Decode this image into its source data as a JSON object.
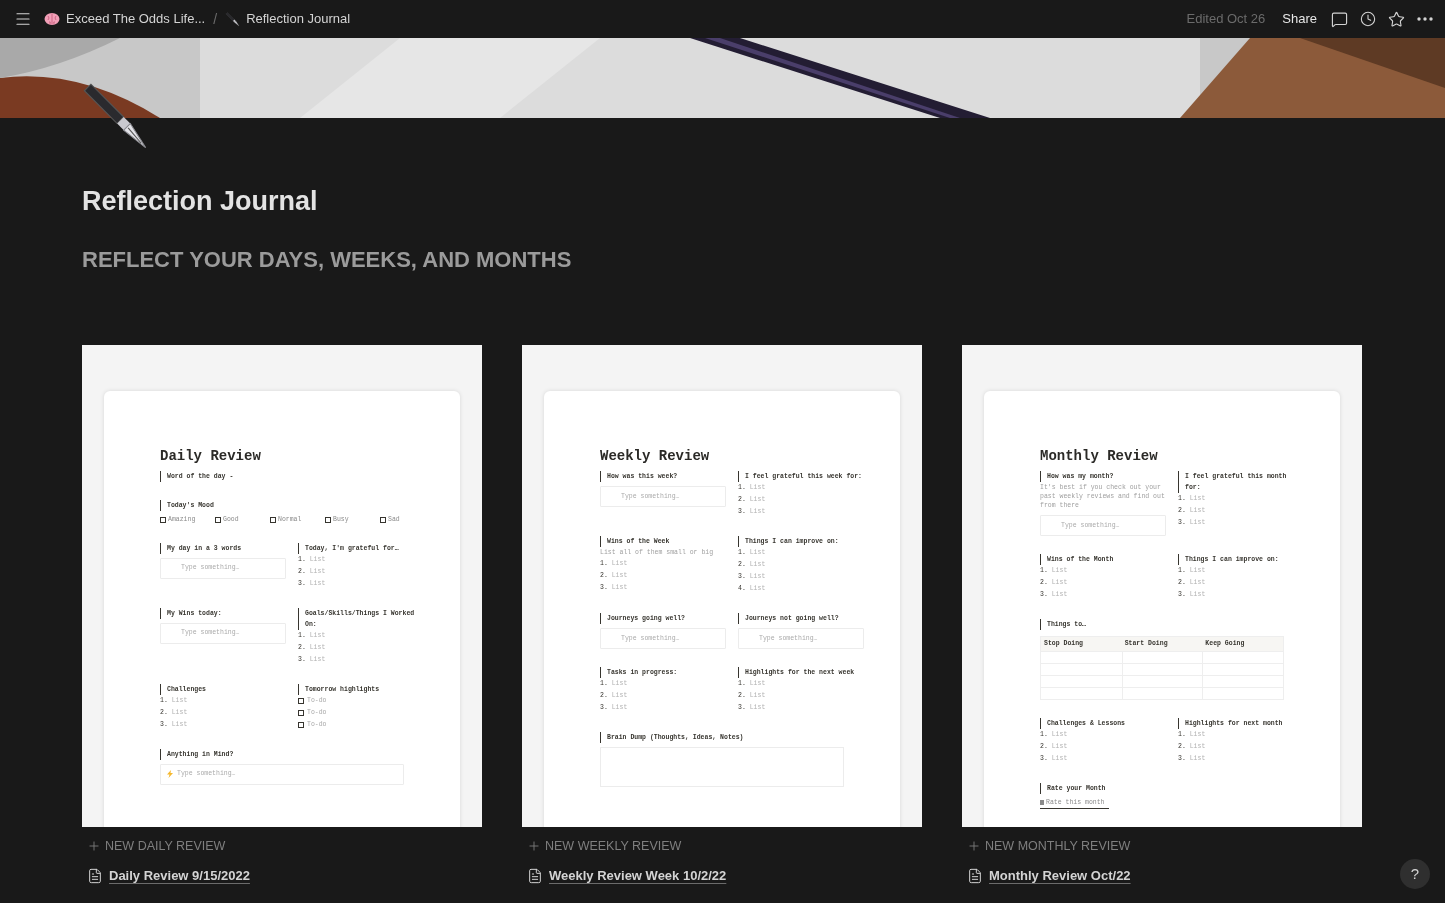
{
  "breadcrumbs": [
    {
      "text": "Exceed The Odds Life..."
    },
    {
      "text": "Reflection Journal"
    }
  ],
  "separator": "/",
  "edited": "Edited Oct 26",
  "share": "Share",
  "page": {
    "title": "Reflection Journal",
    "heading": "REFLECT YOUR DAYS, WEEKS, AND MONTHS"
  },
  "boards": [
    {
      "new_label": "NEW DAILY REVIEW",
      "page_link": "Daily Review 9/15/2022",
      "preview": {
        "title": "Daily Review",
        "rows": [
          {
            "sections": [
              {
                "heading": "Word of the day -"
              }
            ]
          },
          {
            "sections": [
              {
                "heading": "Today's Mood",
                "items": [
                  {
                    "kind": "options",
                    "options": [
                      {
                        "label": "Amazing",
                        "checked": false
                      },
                      {
                        "label": "Good",
                        "checked": false
                      },
                      {
                        "label": "Normal",
                        "checked": false
                      },
                      {
                        "label": "Busy",
                        "checked": false
                      },
                      {
                        "label": "Sad",
                        "checked": false
                      }
                    ]
                  }
                ]
              }
            ]
          },
          {
            "sections": [
              {
                "heading": "My day in a 3 words",
                "items": [
                  {
                    "kind": "field",
                    "placeholder": "Type something…"
                  }
                ]
              },
              {
                "heading": "Today, I'm grateful for…",
                "items": [
                  {
                    "kind": "list",
                    "number": "1.",
                    "text": "List"
                  },
                  {
                    "kind": "list",
                    "number": "2.",
                    "text": "List"
                  },
                  {
                    "kind": "list",
                    "number": "3.",
                    "text": "List"
                  }
                ]
              }
            ]
          },
          {
            "sections": [
              {
                "heading": "My Wins today:",
                "items": [
                  {
                    "kind": "field",
                    "placeholder": "Type something…"
                  }
                ]
              },
              {
                "heading": "Goals/Skills/Things I Worked On:",
                "items": [
                  {
                    "kind": "list",
                    "number": "1.",
                    "text": "List"
                  },
                  {
                    "kind": "list",
                    "number": "2.",
                    "text": "List"
                  },
                  {
                    "kind": "list",
                    "number": "3.",
                    "text": "List"
                  }
                ]
              }
            ]
          },
          {
            "sections": [
              {
                "heading": "Challenges",
                "items": [
                  {
                    "kind": "list",
                    "number": "1.",
                    "text": "List"
                  },
                  {
                    "kind": "list",
                    "number": "2.",
                    "text": "List"
                  },
                  {
                    "kind": "list",
                    "number": "3.",
                    "text": "List"
                  }
                ]
              },
              {
                "heading": "Tomorrow highlights",
                "items": [
                  {
                    "kind": "todo",
                    "text": "To-do",
                    "checked": false
                  },
                  {
                    "kind": "todo",
                    "text": "To-do",
                    "checked": false
                  },
                  {
                    "kind": "todo",
                    "text": "To-do",
                    "checked": false
                  }
                ]
              }
            ]
          },
          {
            "sections": [
              {
                "heading": "Anything in Mind?",
                "items": [
                  {
                    "kind": "bolt_field",
                    "placeholder": "Type something…"
                  }
                ]
              }
            ]
          }
        ]
      }
    },
    {
      "new_label": "NEW WEEKLY REVIEW",
      "page_link": "Weekly Review Week 10/2/22",
      "preview": {
        "title": "Weekly Review",
        "rows": [
          {
            "sections": [
              {
                "heading": "How was this week?",
                "items": [
                  {
                    "kind": "field",
                    "placeholder": "Type something…"
                  }
                ]
              },
              {
                "heading": "I feel grateful this week for:",
                "items": [
                  {
                    "kind": "list",
                    "number": "1.",
                    "text": "List"
                  },
                  {
                    "kind": "list",
                    "number": "2.",
                    "text": "List"
                  },
                  {
                    "kind": "list",
                    "number": "3.",
                    "text": "List"
                  }
                ]
              }
            ]
          },
          {
            "sections": [
              {
                "heading": "Wins of the Week",
                "items": [
                  {
                    "kind": "note",
                    "text": "List all of them small or big"
                  },
                  {
                    "kind": "list",
                    "number": "1.",
                    "text": "List"
                  },
                  {
                    "kind": "list",
                    "number": "2.",
                    "text": "List"
                  },
                  {
                    "kind": "list",
                    "number": "3.",
                    "text": "List"
                  }
                ]
              },
              {
                "heading": "Things I can improve on:",
                "items": [
                  {
                    "kind": "list",
                    "number": "1.",
                    "text": "List"
                  },
                  {
                    "kind": "list",
                    "number": "2.",
                    "text": "List"
                  },
                  {
                    "kind": "list",
                    "number": "3.",
                    "text": "List"
                  },
                  {
                    "kind": "list",
                    "number": "4.",
                    "text": "List"
                  }
                ]
              }
            ]
          },
          {
            "sections": [
              {
                "heading": "Journeys going well?",
                "items": [
                  {
                    "kind": "field",
                    "placeholder": "Type something…"
                  }
                ]
              },
              {
                "heading": "Journeys not going well?",
                "items": [
                  {
                    "kind": "field",
                    "placeholder": "Type something…"
                  }
                ]
              }
            ]
          },
          {
            "sections": [
              {
                "heading": "Tasks in progress:",
                "items": [
                  {
                    "kind": "list",
                    "number": "1.",
                    "text": "List"
                  },
                  {
                    "kind": "list",
                    "number": "2.",
                    "text": "List"
                  },
                  {
                    "kind": "list",
                    "number": "3.",
                    "text": "List"
                  }
                ]
              },
              {
                "heading": "Highlights for the next week",
                "items": [
                  {
                    "kind": "list",
                    "number": "1.",
                    "text": "List"
                  },
                  {
                    "kind": "list",
                    "number": "2.",
                    "text": "List"
                  },
                  {
                    "kind": "list",
                    "number": "3.",
                    "text": "List"
                  }
                ]
              }
            ]
          },
          {
            "sections": [
              {
                "heading": "Brain Dump (Thoughts, Ideas, Notes)",
                "items": [
                  {
                    "kind": "area"
                  }
                ]
              }
            ]
          }
        ]
      }
    },
    {
      "new_label": "NEW MONTHLY REVIEW",
      "page_link": "Monthly Review Oct/22",
      "preview": {
        "title": "Monthly Review",
        "rows": [
          {
            "sections": [
              {
                "heading": "How was my month?",
                "items": [
                  {
                    "kind": "note",
                    "text": "It's best if you check out your past weekly reviews and find out from there"
                  },
                  {
                    "kind": "field",
                    "placeholder": "Type something…"
                  }
                ]
              },
              {
                "heading": "I feel grateful this month for:",
                "items": [
                  {
                    "kind": "list",
                    "number": "1.",
                    "text": "List"
                  },
                  {
                    "kind": "list",
                    "number": "2.",
                    "text": "List"
                  },
                  {
                    "kind": "list",
                    "number": "3.",
                    "text": "List"
                  }
                ]
              }
            ]
          },
          {
            "sections": [
              {
                "heading": "Wins of the Month",
                "items": [
                  {
                    "kind": "list",
                    "number": "1.",
                    "text": "List"
                  },
                  {
                    "kind": "list",
                    "number": "2.",
                    "text": "List"
                  },
                  {
                    "kind": "list",
                    "number": "3.",
                    "text": "List"
                  }
                ]
              },
              {
                "heading": "Things I can improve on:",
                "items": [
                  {
                    "kind": "list",
                    "number": "1.",
                    "text": "List"
                  },
                  {
                    "kind": "list",
                    "number": "2.",
                    "text": "List"
                  },
                  {
                    "kind": "list",
                    "number": "3.",
                    "text": "List"
                  }
                ]
              }
            ]
          },
          {
            "sections": [
              {
                "heading": "Things to…",
                "items": [
                  {
                    "kind": "table",
                    "columns": [
                      "Stop Doing",
                      "Start Doing",
                      "Keep Going"
                    ]
                  }
                ]
              }
            ]
          },
          {
            "sections": [
              {
                "heading": "Challenges & Lessons",
                "items": [
                  {
                    "kind": "list",
                    "number": "1.",
                    "text": "List"
                  },
                  {
                    "kind": "list",
                    "number": "2.",
                    "text": "List"
                  },
                  {
                    "kind": "list",
                    "number": "3.",
                    "text": "List"
                  }
                ]
              },
              {
                "heading": "Highlights for next month",
                "items": [
                  {
                    "kind": "list",
                    "number": "1.",
                    "text": "List"
                  },
                  {
                    "kind": "list",
                    "number": "2.",
                    "text": "List"
                  },
                  {
                    "kind": "list",
                    "number": "3.",
                    "text": "List"
                  }
                ]
              }
            ]
          },
          {
            "sections": [
              {
                "heading": "Rate your Month",
                "items": [
                  {
                    "kind": "property",
                    "text": "Rate this month"
                  }
                ]
              }
            ]
          }
        ]
      }
    }
  ],
  "help": "?"
}
